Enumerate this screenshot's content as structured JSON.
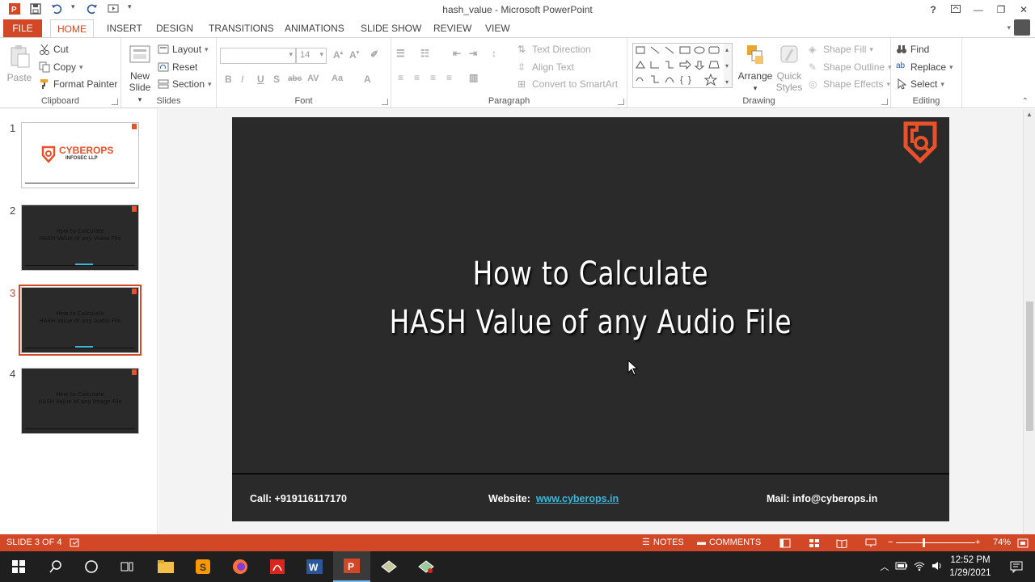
{
  "window": {
    "title": "hash_value - Microsoft PowerPoint",
    "help": "?",
    "minimize": "—",
    "restore": "❐",
    "close": "✕"
  },
  "tabs": [
    "FILE",
    "HOME",
    "INSERT",
    "DESIGN",
    "TRANSITIONS",
    "ANIMATIONS",
    "SLIDE SHOW",
    "REVIEW",
    "VIEW"
  ],
  "active_tab": "HOME",
  "ribbon": {
    "clipboard": {
      "label": "Clipboard",
      "paste": "Paste",
      "cut": "Cut",
      "copy": "Copy",
      "format_painter": "Format Painter"
    },
    "slides": {
      "label": "Slides",
      "new_slide_line1": "New",
      "new_slide_line2": "Slide",
      "layout": "Layout",
      "reset": "Reset",
      "section": "Section"
    },
    "font": {
      "label": "Font",
      "font_size": "14"
    },
    "paragraph": {
      "label": "Paragraph",
      "text_direction": "Text Direction",
      "align_text": "Align Text",
      "convert_smartart": "Convert to SmartArt"
    },
    "drawing": {
      "label": "Drawing",
      "arrange": "Arrange",
      "quick_styles_line1": "Quick",
      "quick_styles_line2": "Styles",
      "shape_fill": "Shape Fill",
      "shape_outline": "Shape Outline",
      "shape_effects": "Shape Effects"
    },
    "editing": {
      "label": "Editing",
      "find": "Find",
      "replace": "Replace",
      "select": "Select"
    }
  },
  "thumbnails": [
    {
      "num": "1",
      "title_line1": "CYBEROPS",
      "title_line2": "INFOSEC LLP"
    },
    {
      "num": "2",
      "title_line1": "How to Calculate",
      "title_line2": "HASH Value of any Video File"
    },
    {
      "num": "3",
      "title_line1": "How to Calculate",
      "title_line2": "HASH Value of any Audio File"
    },
    {
      "num": "4",
      "title_line1": "How to Calculate",
      "title_line2": "HASH Value of any Image File"
    }
  ],
  "selected_slide": 3,
  "slide": {
    "title_line1": "How to Calculate",
    "title_line2": "HASH Value of any Audio File",
    "call": "Call: +919116117170",
    "website_label": "Website:",
    "website_url": "www.cyberops.in",
    "mail": "Mail: info@cyberops.in"
  },
  "status": {
    "slide_indicator": "SLIDE 3 OF 4",
    "notes": "NOTES",
    "comments": "COMMENTS",
    "zoom": "74%"
  },
  "taskbar": {
    "time": "12:52 PM",
    "date": "1/29/2021"
  },
  "colors": {
    "accent": "#d24726",
    "slide_bg": "#2b2a2a",
    "link": "#3ab7d9"
  }
}
